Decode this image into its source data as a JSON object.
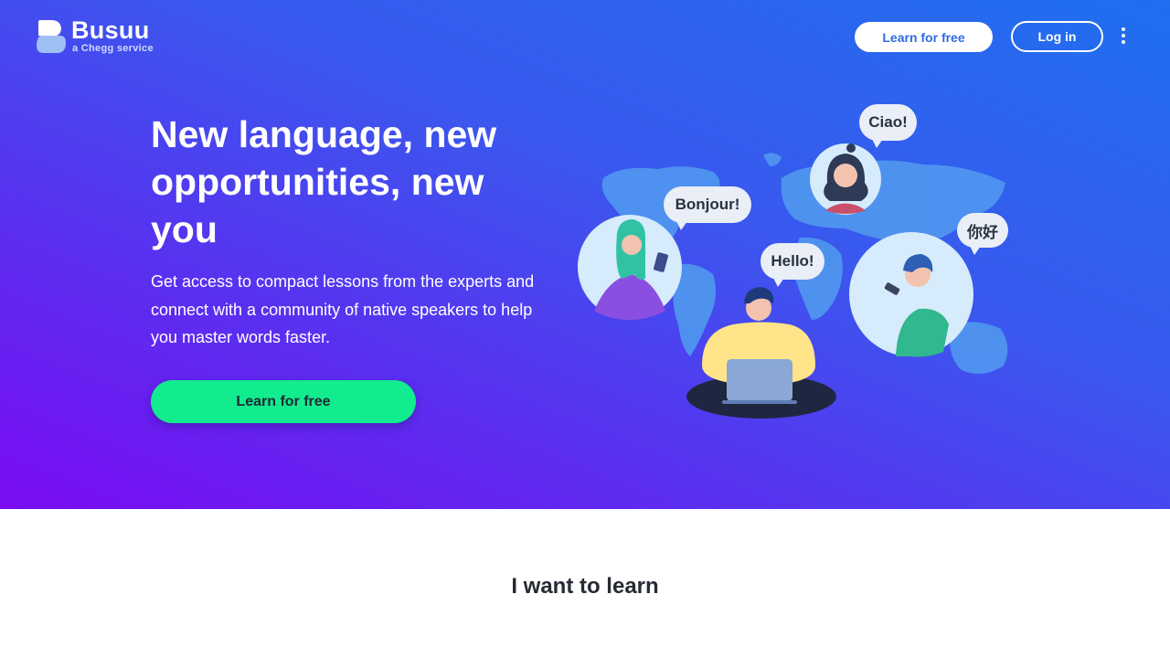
{
  "header": {
    "logo_name": "Busuu",
    "logo_tagline": "a Chegg service",
    "learn_button": "Learn for free",
    "login_button": "Log in",
    "menu_icon": "more-vertical-icon"
  },
  "hero": {
    "headline": "New language, new opportunities, new you",
    "subtext": "Get access to compact lessons from the experts and connect with a community of native speakers to help you master words faster.",
    "cta_button": "Learn for free",
    "speech_bubbles": [
      "Ciao!",
      "Bonjour!",
      "Hello!",
      "你好"
    ]
  },
  "section": {
    "title": "I want to learn"
  },
  "colors": {
    "gradient_start": "#7a0cf2",
    "gradient_end": "#1f6fef",
    "cta_green": "#12ec8e",
    "header_button_text": "#2f6ce5"
  }
}
